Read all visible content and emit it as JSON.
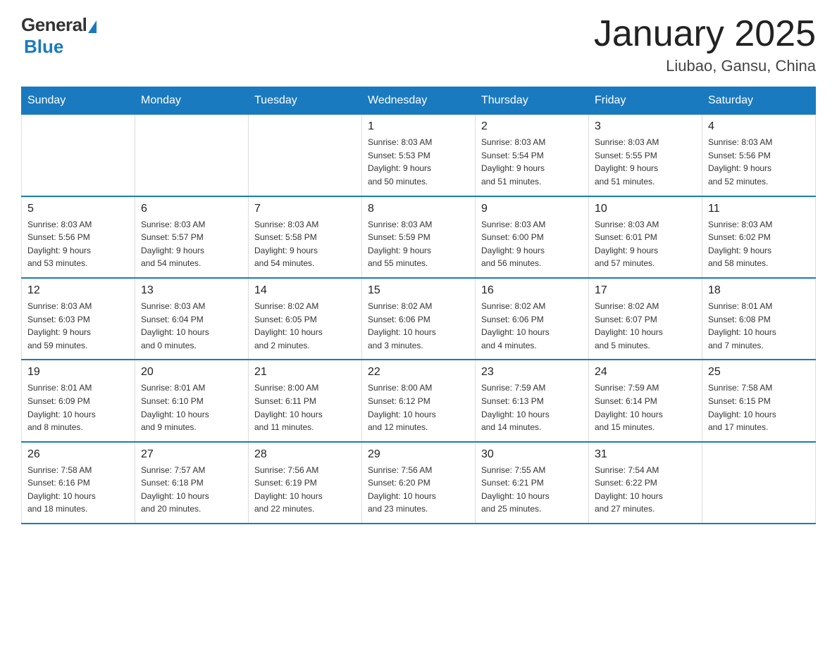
{
  "logo": {
    "general": "General",
    "blue": "Blue",
    "subtitle": "Blue"
  },
  "header": {
    "month_title": "January 2025",
    "location": "Liubao, Gansu, China"
  },
  "days_of_week": [
    "Sunday",
    "Monday",
    "Tuesday",
    "Wednesday",
    "Thursday",
    "Friday",
    "Saturday"
  ],
  "weeks": [
    [
      {
        "num": "",
        "detail": ""
      },
      {
        "num": "",
        "detail": ""
      },
      {
        "num": "",
        "detail": ""
      },
      {
        "num": "1",
        "detail": "Sunrise: 8:03 AM\nSunset: 5:53 PM\nDaylight: 9 hours\nand 50 minutes."
      },
      {
        "num": "2",
        "detail": "Sunrise: 8:03 AM\nSunset: 5:54 PM\nDaylight: 9 hours\nand 51 minutes."
      },
      {
        "num": "3",
        "detail": "Sunrise: 8:03 AM\nSunset: 5:55 PM\nDaylight: 9 hours\nand 51 minutes."
      },
      {
        "num": "4",
        "detail": "Sunrise: 8:03 AM\nSunset: 5:56 PM\nDaylight: 9 hours\nand 52 minutes."
      }
    ],
    [
      {
        "num": "5",
        "detail": "Sunrise: 8:03 AM\nSunset: 5:56 PM\nDaylight: 9 hours\nand 53 minutes."
      },
      {
        "num": "6",
        "detail": "Sunrise: 8:03 AM\nSunset: 5:57 PM\nDaylight: 9 hours\nand 54 minutes."
      },
      {
        "num": "7",
        "detail": "Sunrise: 8:03 AM\nSunset: 5:58 PM\nDaylight: 9 hours\nand 54 minutes."
      },
      {
        "num": "8",
        "detail": "Sunrise: 8:03 AM\nSunset: 5:59 PM\nDaylight: 9 hours\nand 55 minutes."
      },
      {
        "num": "9",
        "detail": "Sunrise: 8:03 AM\nSunset: 6:00 PM\nDaylight: 9 hours\nand 56 minutes."
      },
      {
        "num": "10",
        "detail": "Sunrise: 8:03 AM\nSunset: 6:01 PM\nDaylight: 9 hours\nand 57 minutes."
      },
      {
        "num": "11",
        "detail": "Sunrise: 8:03 AM\nSunset: 6:02 PM\nDaylight: 9 hours\nand 58 minutes."
      }
    ],
    [
      {
        "num": "12",
        "detail": "Sunrise: 8:03 AM\nSunset: 6:03 PM\nDaylight: 9 hours\nand 59 minutes."
      },
      {
        "num": "13",
        "detail": "Sunrise: 8:03 AM\nSunset: 6:04 PM\nDaylight: 10 hours\nand 0 minutes."
      },
      {
        "num": "14",
        "detail": "Sunrise: 8:02 AM\nSunset: 6:05 PM\nDaylight: 10 hours\nand 2 minutes."
      },
      {
        "num": "15",
        "detail": "Sunrise: 8:02 AM\nSunset: 6:06 PM\nDaylight: 10 hours\nand 3 minutes."
      },
      {
        "num": "16",
        "detail": "Sunrise: 8:02 AM\nSunset: 6:06 PM\nDaylight: 10 hours\nand 4 minutes."
      },
      {
        "num": "17",
        "detail": "Sunrise: 8:02 AM\nSunset: 6:07 PM\nDaylight: 10 hours\nand 5 minutes."
      },
      {
        "num": "18",
        "detail": "Sunrise: 8:01 AM\nSunset: 6:08 PM\nDaylight: 10 hours\nand 7 minutes."
      }
    ],
    [
      {
        "num": "19",
        "detail": "Sunrise: 8:01 AM\nSunset: 6:09 PM\nDaylight: 10 hours\nand 8 minutes."
      },
      {
        "num": "20",
        "detail": "Sunrise: 8:01 AM\nSunset: 6:10 PM\nDaylight: 10 hours\nand 9 minutes."
      },
      {
        "num": "21",
        "detail": "Sunrise: 8:00 AM\nSunset: 6:11 PM\nDaylight: 10 hours\nand 11 minutes."
      },
      {
        "num": "22",
        "detail": "Sunrise: 8:00 AM\nSunset: 6:12 PM\nDaylight: 10 hours\nand 12 minutes."
      },
      {
        "num": "23",
        "detail": "Sunrise: 7:59 AM\nSunset: 6:13 PM\nDaylight: 10 hours\nand 14 minutes."
      },
      {
        "num": "24",
        "detail": "Sunrise: 7:59 AM\nSunset: 6:14 PM\nDaylight: 10 hours\nand 15 minutes."
      },
      {
        "num": "25",
        "detail": "Sunrise: 7:58 AM\nSunset: 6:15 PM\nDaylight: 10 hours\nand 17 minutes."
      }
    ],
    [
      {
        "num": "26",
        "detail": "Sunrise: 7:58 AM\nSunset: 6:16 PM\nDaylight: 10 hours\nand 18 minutes."
      },
      {
        "num": "27",
        "detail": "Sunrise: 7:57 AM\nSunset: 6:18 PM\nDaylight: 10 hours\nand 20 minutes."
      },
      {
        "num": "28",
        "detail": "Sunrise: 7:56 AM\nSunset: 6:19 PM\nDaylight: 10 hours\nand 22 minutes."
      },
      {
        "num": "29",
        "detail": "Sunrise: 7:56 AM\nSunset: 6:20 PM\nDaylight: 10 hours\nand 23 minutes."
      },
      {
        "num": "30",
        "detail": "Sunrise: 7:55 AM\nSunset: 6:21 PM\nDaylight: 10 hours\nand 25 minutes."
      },
      {
        "num": "31",
        "detail": "Sunrise: 7:54 AM\nSunset: 6:22 PM\nDaylight: 10 hours\nand 27 minutes."
      },
      {
        "num": "",
        "detail": ""
      }
    ]
  ]
}
